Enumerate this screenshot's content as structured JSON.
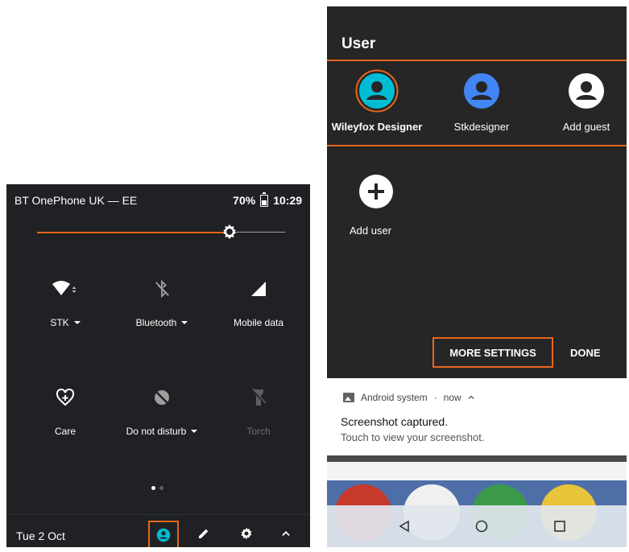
{
  "left_panel": {
    "status": {
      "carrier": "BT OnePhone UK — EE",
      "battery": "70%",
      "time": "10:29"
    },
    "brightness": {
      "level": 0.79
    },
    "tiles": [
      {
        "label": "STK",
        "icon": "wifi-icon",
        "has_dropdown": true
      },
      {
        "label": "Bluetooth",
        "icon": "bluetooth-off-icon",
        "has_dropdown": true
      },
      {
        "label": "Mobile data",
        "icon": "signal-icon",
        "has_dropdown": false
      },
      {
        "label": "Care",
        "icon": "heart-plus-icon",
        "has_dropdown": false
      },
      {
        "label": "Do not disturb",
        "icon": "do-not-disturb-icon",
        "has_dropdown": true
      },
      {
        "label": "Torch",
        "icon": "torch-off-icon",
        "has_dropdown": false,
        "disabled": true
      }
    ],
    "footer": {
      "date": "Tue 2 Oct"
    }
  },
  "right_panel": {
    "title": "User",
    "users": [
      {
        "name": "Wileyfox Designer",
        "color": "#00bcd4",
        "selected": true
      },
      {
        "name": "Stkdesigner",
        "color": "#4285f4",
        "selected": false
      },
      {
        "name": "Add guest",
        "color": "#ffffff",
        "selected": false
      }
    ],
    "add_user_label": "Add user",
    "more_settings_label": "MORE SETTINGS",
    "done_label": "DONE",
    "notification": {
      "app": "Android system",
      "time": "now",
      "title": "Screenshot captured.",
      "text": "Touch to view your screenshot."
    }
  },
  "colors": {
    "accent": "#e8661d",
    "panel_dark": "#202124",
    "user_panel": "#262626"
  }
}
